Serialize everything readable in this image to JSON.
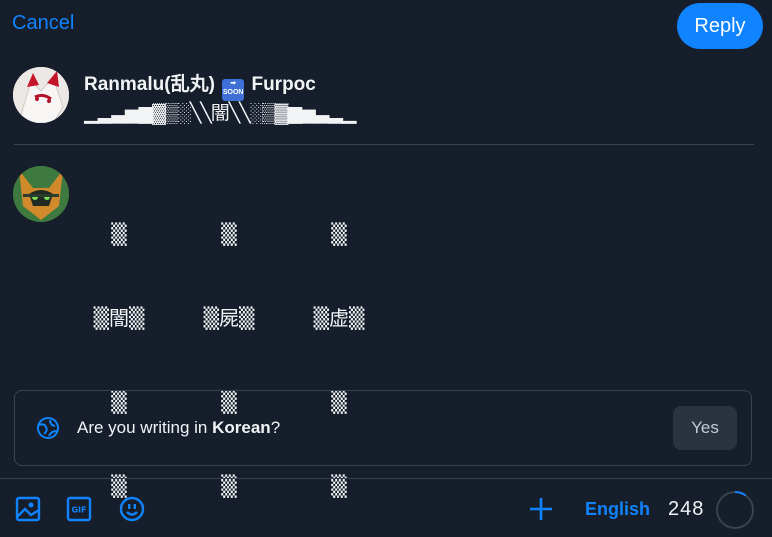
{
  "header": {
    "cancel_label": "Cancel",
    "reply_label": "Reply"
  },
  "parent_post": {
    "name_prefix": "Ranmalu(乱丸)",
    "soon_badge": "SOON",
    "name_suffix": "Furpoc",
    "text": "▁▂▃▅▆▓▒░╲╲闇╲╲░▒▓▆▅▃▂▁"
  },
  "composer": {
    "columns": [
      [
        "▒",
        "▒闇▒",
        "▒",
        "▒"
      ],
      [
        "▒",
        "▒屍▒",
        "▒",
        "▒"
      ],
      [
        "▒",
        "▒虚▒",
        "▒",
        "▒"
      ]
    ]
  },
  "language_suggestion": {
    "prompt_prefix": "Are you writing in ",
    "language": "Korean",
    "prompt_suffix": "?",
    "yes_label": "Yes"
  },
  "toolbar": {
    "icons": [
      "image-icon",
      "gif-icon",
      "emoji-icon",
      "add-icon"
    ],
    "language_label": "English",
    "remaining_chars": "248",
    "remaining_fraction": 0.1
  },
  "colors": {
    "accent": "#1083fe",
    "background": "#161e2b",
    "border": "#38434f"
  }
}
